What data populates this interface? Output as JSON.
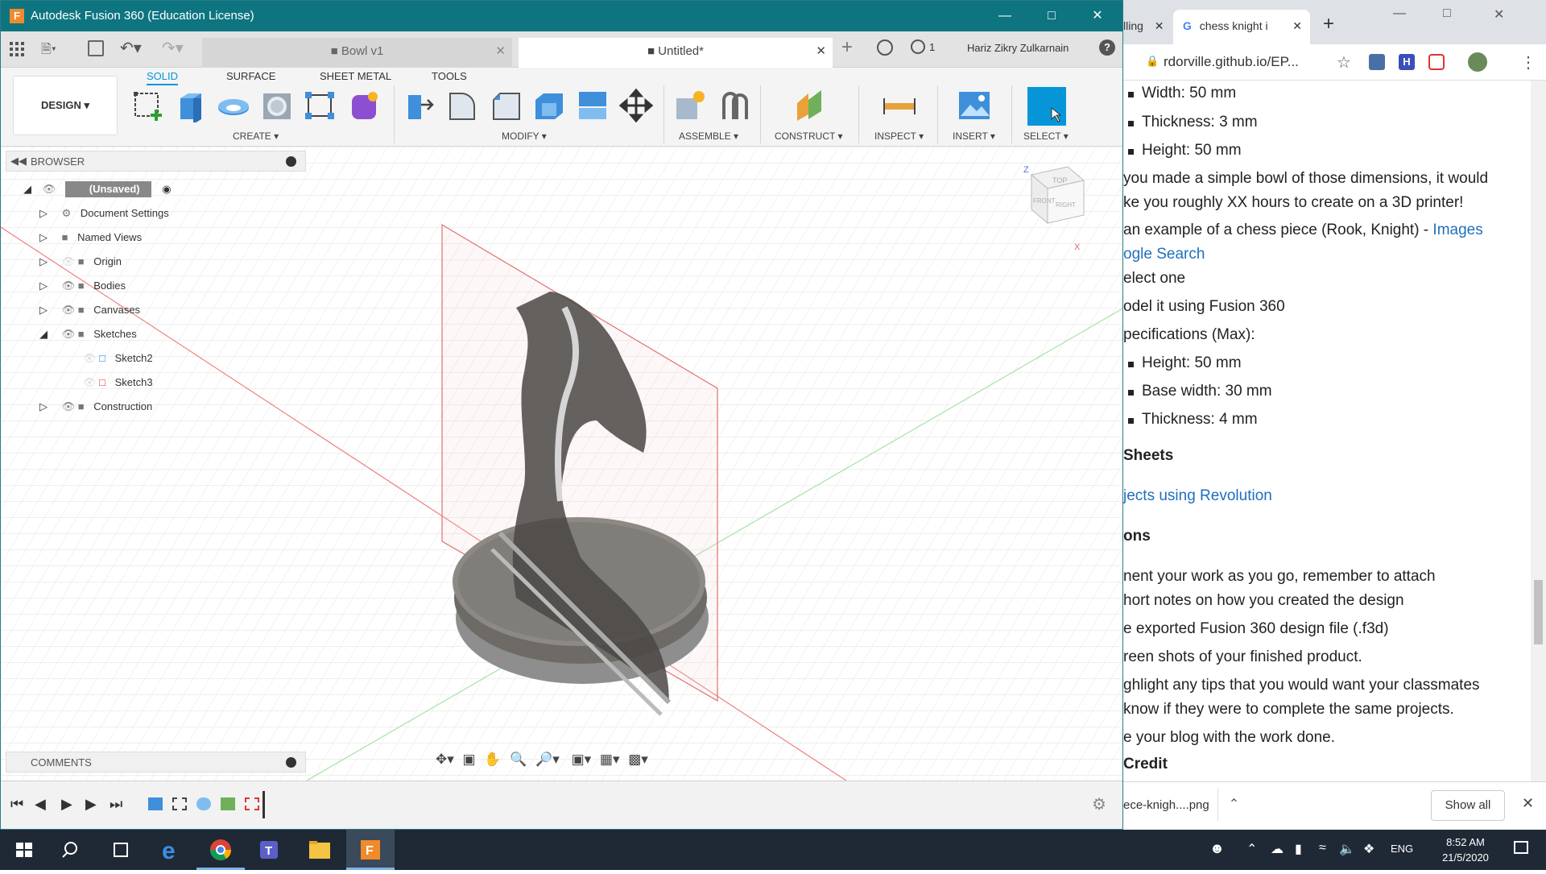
{
  "fusion": {
    "title": "Autodesk Fusion 360 (Education License)",
    "tabs": [
      {
        "label": "Bowl v1"
      },
      {
        "label": "Untitled*"
      }
    ],
    "job_count": "1",
    "user": "Hariz Zikry Zulkarnain",
    "workspace": "DESIGN ▾",
    "ribbon_tabs": [
      "SOLID",
      "SURFACE",
      "SHEET METAL",
      "TOOLS"
    ],
    "groups": [
      "CREATE ▾",
      "MODIFY ▾",
      "ASSEMBLE ▾",
      "CONSTRUCT ▾",
      "INSPECT ▾",
      "INSERT ▾",
      "SELECT ▾"
    ],
    "browser": {
      "title": "BROWSER",
      "root": "(Unsaved)",
      "items": [
        "Document Settings",
        "Named Views",
        "Origin",
        "Bodies",
        "Canvases",
        "Sketches",
        "Sketch2",
        "Sketch3",
        "Construction"
      ]
    },
    "comments": "COMMENTS",
    "viewcube": {
      "top": "TOP",
      "front": "FRONT",
      "right": "RIGHT",
      "z": "Z",
      "x": "X"
    }
  },
  "chrome": {
    "tab1": "lling",
    "tab2": "chess knight i",
    "url": "rdorville.github.io/EP...",
    "content": {
      "width": "Width: 50 mm",
      "thickness3": "Thickness: 3 mm",
      "height50": "Height: 50 mm",
      "para1a": "you made a simple bowl of those dimensions, it would",
      "para1b": "ke you roughly XX hours to create on a 3D printer!",
      "example_a": "an example of a chess piece (Rook, Knight) - ",
      "images_link": "Images",
      "google_link": "ogle Search",
      "select_one": "elect one",
      "model_it": "odel it using Fusion 360",
      "specs": "pecifications (Max):",
      "spec_height": "Height: 50 mm",
      "spec_base": "Base width: 30 mm",
      "spec_thick": "Thickness: 4 mm",
      "sheets": "Sheets",
      "revolution_link": "jects using Revolution",
      "ons": "ons",
      "doc1a": "nent your work as you go, remember to attach",
      "doc1b": "hort notes on how you created the design",
      "doc2": "e exported Fusion 360 design file (.f3d)",
      "doc3": "reen shots of your finished product.",
      "doc4a": "ghlight any tips that you would want your classmates",
      "doc4b": "know if they were to complete the same projects.",
      "doc5": "e your blog with the work done.",
      "credit": "Credit"
    },
    "download": {
      "file": "ece-knigh....png",
      "show_all": "Show all"
    }
  },
  "taskbar": {
    "lang": "ENG",
    "time": "8:52 AM",
    "date": "21/5/2020"
  },
  "colors": {
    "fusion_title": "#0e7580",
    "ribbon_accent": "#0696d7",
    "taskbar": "#1f2935",
    "link": "#1f6fbf"
  }
}
